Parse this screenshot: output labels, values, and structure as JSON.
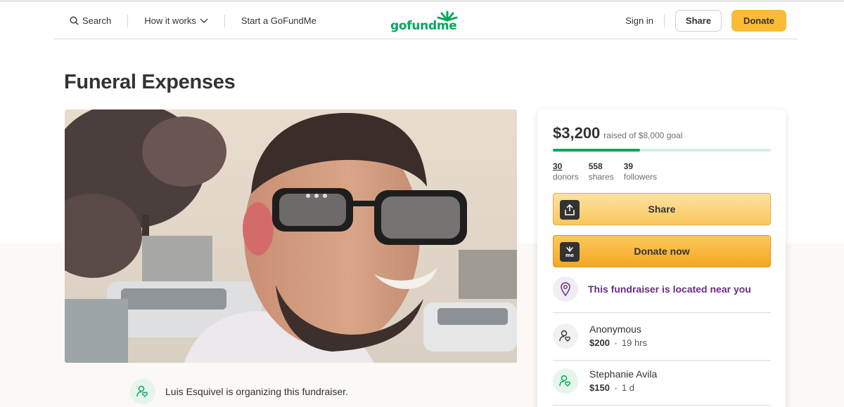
{
  "nav": {
    "search": "Search",
    "how_it_works": "How it works",
    "start": "Start a GoFundMe",
    "logo": "gofundme",
    "sign_in": "Sign in",
    "share": "Share",
    "donate": "Donate"
  },
  "campaign": {
    "title": "Funeral Expenses",
    "organizer_text": "Luis Esquivel is organizing this fundraiser."
  },
  "donation": {
    "raised": "$3,200",
    "goal_text": "raised of $8,000 goal",
    "progress_fraction": 0.4,
    "stats": [
      {
        "value": "30",
        "label": "donors"
      },
      {
        "value": "558",
        "label": "shares"
      },
      {
        "value": "39",
        "label": "followers"
      }
    ],
    "share_button": "Share",
    "donate_button": "Donate now",
    "nearby_text": "This fundraiser is located near you",
    "donors": [
      {
        "name": "Anonymous",
        "amount": "$200",
        "time": "19 hrs"
      },
      {
        "name": "Stephanie Avila",
        "amount": "$150",
        "time": "1 d"
      }
    ]
  },
  "colors": {
    "brand_green": "#02a95c",
    "donate_yellow": "#fbbb36",
    "nearby_purple": "#6b2b86",
    "band_beige": "#fbf8f6"
  },
  "icons": [
    "search-icon",
    "chevron-down-icon",
    "share-upload-icon",
    "gofundme-me-icon",
    "location-pin-icon",
    "person-heart-icon"
  ]
}
